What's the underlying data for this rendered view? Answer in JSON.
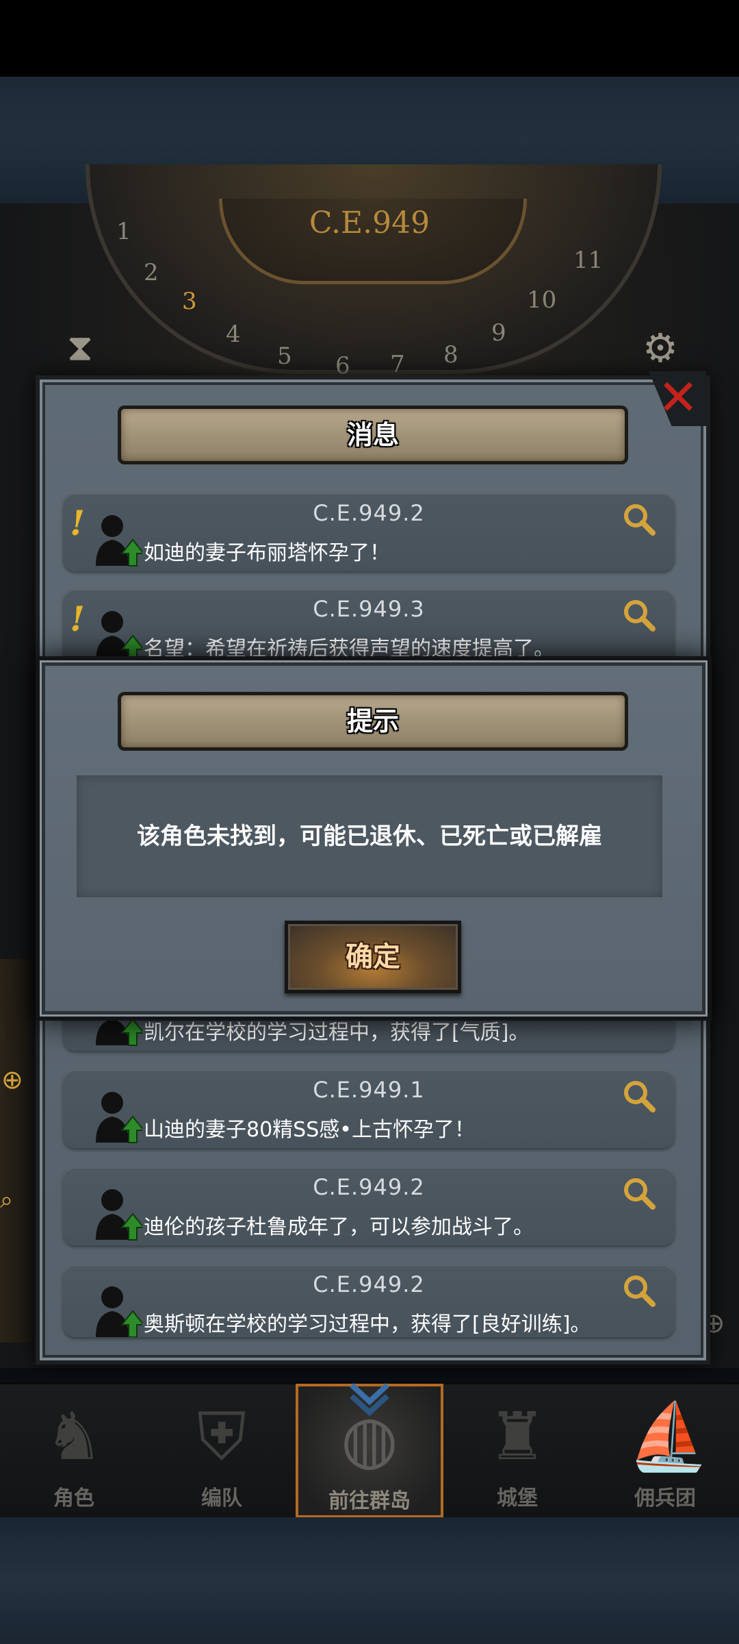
{
  "header": {
    "era": "C.E.949",
    "dial_numbers": [
      "1",
      "2",
      "3",
      "4",
      "5",
      "6",
      "7",
      "8",
      "9",
      "10",
      "11"
    ]
  },
  "message_panel": {
    "title": "消息",
    "items": [
      {
        "date": "C.E.949.2",
        "text": "如迪的妻子布丽塔怀孕了！",
        "alert": true
      },
      {
        "date": "C.E.949.3",
        "text": "名望：希望在祈祷后获得声望的速度提高了。",
        "alert": true
      },
      {
        "date": "",
        "text": "凯尔在学校的学习过程中，获得了[气质]。",
        "alert": false
      },
      {
        "date": "C.E.949.1",
        "text": "山迪的妻子80精SS感•上古怀孕了！",
        "alert": false
      },
      {
        "date": "C.E.949.2",
        "text": "迪伦的孩子杜鲁成年了，可以参加战斗了。",
        "alert": false
      },
      {
        "date": "C.E.949.2",
        "text": "奥斯顿在学校的学习过程中，获得了[良好训练]。",
        "alert": false
      }
    ]
  },
  "dialog": {
    "title": "提示",
    "message": "该角色未找到，可能已退休、已死亡或已解雇",
    "confirm_label": "确定"
  },
  "nav": {
    "items": [
      {
        "label": "角色",
        "icon": "knight-icon",
        "active": false
      },
      {
        "label": "编队",
        "icon": "team-icon",
        "active": false
      },
      {
        "label": "前往群岛",
        "icon": "globe-icon",
        "active": true
      },
      {
        "label": "城堡",
        "icon": "castle-icon",
        "active": false
      },
      {
        "label": "佣兵团",
        "icon": "ship-icon",
        "active": false
      }
    ]
  },
  "colors": {
    "accent_gold": "#b58a3c",
    "close_red": "#c4221d",
    "panel_gray": "#5e6a74",
    "active_orange": "#b36a24",
    "arrow_green": "#2e8b2a"
  }
}
